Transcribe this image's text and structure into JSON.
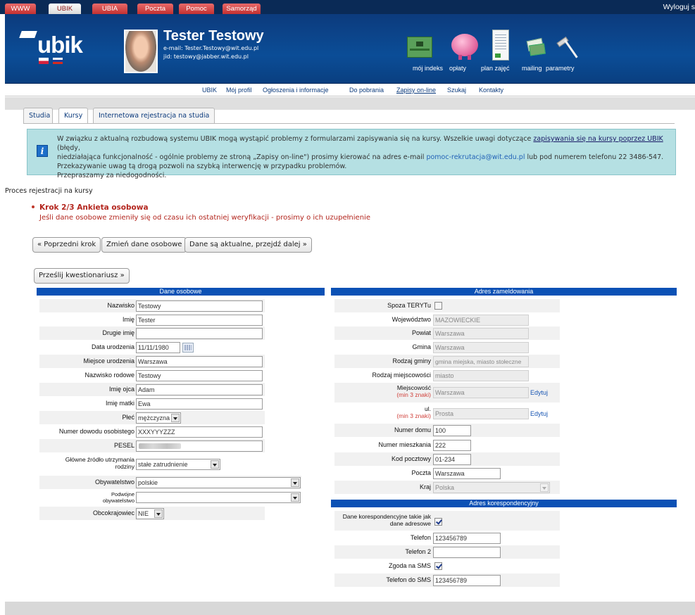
{
  "top_tabs": [
    "WWW",
    "UBIK",
    "UBIA",
    "Poczta",
    "Pomoc",
    "Samorząd"
  ],
  "top_active": "UBIK",
  "logout": "Wyloguj s",
  "logo_text": "ubik",
  "user": {
    "name": "Tester Testowy",
    "email": "e-mail: Tester.Testowy@wit.edu.pl",
    "jid": "jid: testowy@jabber.wit.edu.pl"
  },
  "header_icons": [
    {
      "icon": "id-card-icon",
      "label": "mój indeks"
    },
    {
      "icon": "piggy-bank-icon",
      "label": "opłaty"
    },
    {
      "icon": "schedule-document-icon",
      "label": "plan zajęć"
    },
    {
      "icon": "mailing-envelopes-icon",
      "label": "mailing"
    },
    {
      "icon": "hammer-icon",
      "label": "parametry"
    }
  ],
  "nav": [
    "UBIK",
    "Mój profil",
    "Ogłoszenia i informacje",
    "Do pobrania",
    "Zapisy on-line",
    "Szukaj",
    "Kontakty"
  ],
  "nav_active": "Zapisy on-line",
  "tabs": [
    "Studia",
    "Kursy",
    "Internetowa rejestracja na studia"
  ],
  "active_tab": "Kursy",
  "notice": {
    "l1a": "W związku z aktualną rozbudową systemu UBIK mogą wystąpić problemy z formularzami zapisywania się na kursy. Wszelkie uwagi dotyczące ",
    "l1link": "zapisywania się na kursy poprzez UBIK",
    "l1b": " (błędy,",
    "l2a": "niedziałająca funkcjonalność - ogólnie problemy ze stroną „Zapisy on-line\") prosimy kierować na adres e-mail ",
    "l2email": "pomoc-rekrutacja@wit.edu.pl",
    "l2b": " lub pod numerem telefonu 22 3486-547.",
    "l3": "Przekazywanie uwag tą drogą pozwoli na szybką interwencję w przypadku problemów.",
    "l4": "Przepraszamy za niedogodności."
  },
  "process": {
    "title": "Proces rejestracji na kursy",
    "step": "Krok 2/3 Ankieta osobowa",
    "step_sub": "Jeśli dane osobowe zmieniły się od czasu ich ostatniej weryfikacji - prosimy o ich uzupełnienie"
  },
  "buttons": {
    "prev": "« Poprzedni krok",
    "change": "Zmień dane osobowe",
    "next": "Dane są aktualne, przejdź dalej »",
    "submit": "Prześlij kwestionariusz »"
  },
  "left": {
    "title": "Dane osobowe",
    "nazwisko": {
      "label": "Nazwisko",
      "value": "Testowy"
    },
    "imie": {
      "label": "Imię",
      "value": "Tester"
    },
    "drugie_imie": {
      "label": "Drugie imię",
      "value": ""
    },
    "data_ur": {
      "label": "Data urodzenia",
      "value": "11/11/1980"
    },
    "miejsce_ur": {
      "label": "Miejsce urodzenia",
      "value": "Warszawa"
    },
    "nazwisko_rod": {
      "label": "Nazwisko rodowe",
      "value": "Testowy"
    },
    "imie_ojca": {
      "label": "Imię ojca",
      "value": "Adam"
    },
    "imie_matki": {
      "label": "Imię matki",
      "value": "Ewa"
    },
    "plec": {
      "label": "Płeć",
      "value": "mężczyzna"
    },
    "dowod": {
      "label": "Numer dowodu osobistego",
      "value": "XXXYYYZZZ"
    },
    "pesel": {
      "label": "PESEL",
      "value": ""
    },
    "zrodlo": {
      "label1": "Główne źródło utrzymania",
      "label2": "rodziny",
      "value": "stałe zatrudnienie"
    },
    "obywatelstwo": {
      "label": "Obywatelstwo",
      "value": "polskie"
    },
    "podwojne": {
      "label1": "Podwójne",
      "label2": "obywatelstwo",
      "value": ""
    },
    "obcokrajowiec": {
      "label": "Obcokrajowiec",
      "value": "NIE"
    }
  },
  "right": {
    "title": "Adres zameldowania",
    "spoza": {
      "label": "Spoza TERYTu",
      "checked": false
    },
    "wojewodztwo": {
      "label": "Województwo",
      "value": "MAZOWIECKIE"
    },
    "powiat": {
      "label": "Powiat",
      "value": "Warszawa"
    },
    "gmina": {
      "label": "Gmina",
      "value": "Warszawa"
    },
    "rodzaj_gminy": {
      "label": "Rodzaj gminy",
      "value": "gmina miejska, miasto stołeczne"
    },
    "rodzaj_miejsc": {
      "label": "Rodzaj miejscowości",
      "value": "miasto"
    },
    "miejscowosc": {
      "label": "Miejscowość",
      "hint": "(min 3 znaki)",
      "value": "Warszawa",
      "edit": "Edytuj"
    },
    "ulica": {
      "label": "ul.",
      "hint": "(min 3 znaki)",
      "value": "Prosta",
      "edit": "Edytuj"
    },
    "nr_domu": {
      "label": "Numer domu",
      "value": "100"
    },
    "nr_mieszk": {
      "label": "Numer mieszkania",
      "value": "222"
    },
    "kod": {
      "label": "Kod pocztowy",
      "value": "01-234"
    },
    "poczta": {
      "label": "Poczta",
      "value": "Warszawa"
    },
    "kraj": {
      "label": "Kraj",
      "value": "Polska"
    }
  },
  "corr": {
    "title": "Adres korespondencyjny",
    "same": {
      "label1": "Dane korespondencyjne takie jak",
      "label2": "dane adresowe",
      "checked": true
    },
    "telefon": {
      "label": "Telefon",
      "value": "123456789"
    },
    "telefon2": {
      "label": "Telefon 2",
      "value": ""
    },
    "sms": {
      "label": "Zgoda na SMS",
      "checked": true
    },
    "telefon_sms": {
      "label": "Telefon do SMS",
      "value": "123456789"
    }
  },
  "colors": {
    "header": "#0b4d97",
    "panel_title": "#0b51b5",
    "notice_bg": "#b5e0e3",
    "step_red": "#b3261e"
  }
}
